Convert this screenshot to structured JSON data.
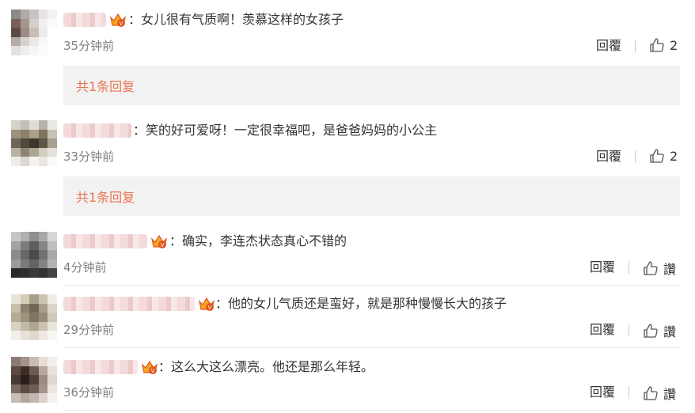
{
  "comments": [
    {
      "text": "：女儿很有气质啊！羡慕这样的女孩子",
      "time": "35分钟前",
      "reply_label": "回覆",
      "like_label": "2",
      "replies_label": "共1条回复",
      "avatar": [
        "#8a8a8a",
        "#b3a9a6",
        "#c7c2c0",
        "#e6e4e3",
        "#f3f3f3",
        "#7a5f59",
        "#a5958f",
        "#d4cfcc",
        "#efefef",
        "#fbfbfb",
        "#5b4b46",
        "#9d8a84",
        "#c8bdb9",
        "#ecebea",
        "#ffffff",
        "#b5aaa6",
        "#d8d2cf",
        "#ebe8e6",
        "#f7f7f7",
        "#ffffff",
        "#e3e1e0",
        "#eeeeee",
        "#f6f6f6",
        "#fbfbfb",
        "#ffffff"
      ]
    },
    {
      "text": "：笑的好可爱呀！一定很幸福吧，是爸爸妈妈的小公主",
      "time": "33分钟前",
      "reply_label": "回覆",
      "like_label": "2",
      "replies_label": "共1条回复",
      "avatar": [
        "#d7d2c9",
        "#c4bfb6",
        "#e0ddd6",
        "#b8b2a8",
        "#eae8e4",
        "#9b927f",
        "#8a7f6a",
        "#a99f8b",
        "#7e745f",
        "#c8c2b6",
        "#6d6656",
        "#4f493c",
        "#3c372d",
        "#5d5647",
        "#a79f8f",
        "#b8b2a4",
        "#8c8574",
        "#aca592",
        "#d2cdc2",
        "#e4e1da",
        "#eeece8",
        "#dcd8cf",
        "#f4f3f1",
        "#e9e6e0",
        "#f9f9f8"
      ]
    },
    {
      "text": "：确实，李连杰状态真心不错的",
      "time": "4分钟前",
      "reply_label": "回覆",
      "like_label": "讚",
      "avatar": [
        "#c6c6c6",
        "#b0b0b0",
        "#8f8f8f",
        "#a9a9a9",
        "#d7d7d7",
        "#a3a3a3",
        "#7c7c7c",
        "#5e5e5e",
        "#858585",
        "#bfbfbf",
        "#8b8b8b",
        "#686868",
        "#4a4a4a",
        "#707070",
        "#a8a8a8",
        "#9c9c9c",
        "#7a7a7a",
        "#646464",
        "#828282",
        "#b4b4b4",
        "#2a2a2a",
        "#303030",
        "#3a3a3a",
        "#333333",
        "#444444"
      ]
    },
    {
      "text": "：他的女儿气质还是蛮好，就是那种慢慢长大的孩子",
      "time": "29分钟前",
      "reply_label": "回覆",
      "like_label": "讚",
      "avatar": [
        "#e8e4da",
        "#d6cdb8",
        "#a9a08a",
        "#cbc4b0",
        "#f0ede6",
        "#c7bfa9",
        "#8c8270",
        "#6f6655",
        "#a89e88",
        "#dcd6c8",
        "#b3ab96",
        "#9c937d",
        "#7f7662",
        "#958c77",
        "#cfc9b9",
        "#d8d2c2",
        "#c2baa6",
        "#aea690",
        "#c9c2ae",
        "#e8e5dc",
        "#f2f0ea",
        "#e6e2d6",
        "#dfdacc",
        "#ece9e1",
        "#f7f6f2"
      ]
    },
    {
      "text": "：这么大这么漂亮。他还是那么年轻。",
      "time": "36分钟前",
      "reply_label": "回覆",
      "like_label": "讚",
      "avatar": [
        "#8a7a70",
        "#a2928a",
        "#c9bcb4",
        "#e6ddd7",
        "#f3efec",
        "#5c4a42",
        "#3a2c26",
        "#6e5a50",
        "#b8a79e",
        "#e8e0da",
        "#4a3a34",
        "#2b1f1a",
        "#4f3f38",
        "#9b8a80",
        "#e1d8d2",
        "#7a6a62",
        "#5b4b44",
        "#6d5d55",
        "#a39389",
        "#ece5e0",
        "#c9bdb6",
        "#b4a69e",
        "#c2b5ad",
        "#ddd3cd",
        "#f5f1ee"
      ]
    }
  ]
}
